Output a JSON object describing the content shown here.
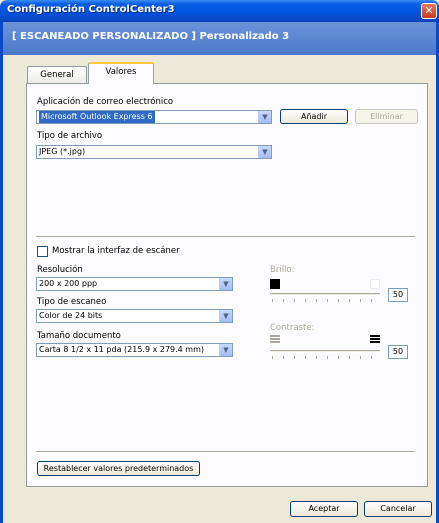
{
  "window": {
    "title": "Configuración ControlCenter3",
    "close_glyph": "✕"
  },
  "banner": {
    "text": "[ ESCANEADO PERSONALIZADO ]  Personalizado 3"
  },
  "tabs": [
    {
      "label": "General",
      "active": false
    },
    {
      "label": "Valores",
      "active": true
    }
  ],
  "email_app": {
    "label": "Aplicación de correo electrónico",
    "value": "Microsoft Outlook Express 6",
    "add_button": "Añadir",
    "remove_button": "Eliminar"
  },
  "file_type": {
    "label": "Tipo de archivo",
    "value": "JPEG (*.jpg)"
  },
  "scanner_interface": {
    "label": "Mostrar la interfaz de escáner",
    "checked": false
  },
  "resolution": {
    "label": "Resolución",
    "value": "200 x 200 ppp"
  },
  "scan_type": {
    "label": "Tipo de escaneo",
    "value": "Color de 24 bits"
  },
  "document_size": {
    "label": "Tamaño documento",
    "value": "Carta 8 1/2 x 11 pda (215.9 x 279.4 mm)"
  },
  "brightness": {
    "label": "Brillo:",
    "value": "50"
  },
  "contrast": {
    "label": "Contraste:",
    "value": "50"
  },
  "reset_button": "Restablecer valores predeterminados",
  "footer": {
    "ok_button": "Aceptar",
    "cancel_button": "Cancelar"
  },
  "colors": {
    "titlebar": "#0053e0",
    "banner": "#5a84cc",
    "selection": "#316ac5",
    "dialog_bg": "#ece9d8"
  }
}
